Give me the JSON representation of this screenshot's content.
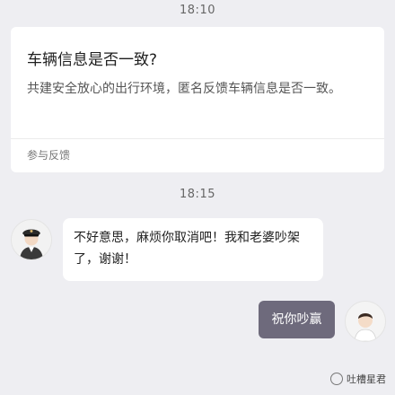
{
  "chat": {
    "time_1": "18:10",
    "time_2": "18:15"
  },
  "feedback_card": {
    "title": "车辆信息是否一致?",
    "description": "共建安全放心的出行环境，匿名反馈车辆信息是否一致。",
    "action_label": "参与反馈"
  },
  "messages": [
    {
      "sender": "driver",
      "avatar_icon": "driver-avatar-icon",
      "text": "不好意思，麻烦你取消吧！我和老婆吵架了，谢谢！"
    },
    {
      "sender": "passenger",
      "avatar_icon": "passenger-avatar-icon",
      "text": "祝你吵赢"
    }
  ],
  "watermark": {
    "text": "吐槽星君",
    "icon": "wechat-official-account-icon"
  },
  "colors": {
    "background": "#eeeef2",
    "card": "#ffffff",
    "outgoing_bubble": "#6e6a7c"
  }
}
